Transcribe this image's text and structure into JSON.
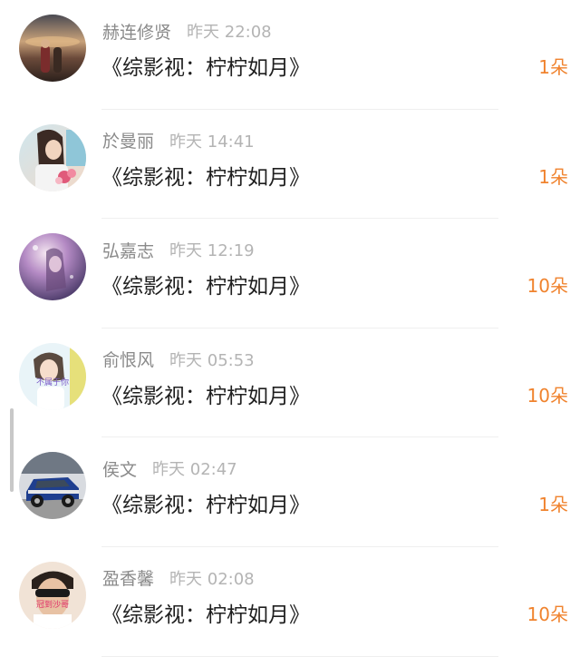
{
  "items": [
    {
      "name": "赫连修贤",
      "time": "昨天 22:08",
      "title": "《综影视：柠柠如月》",
      "count": "1朵",
      "avatar": "sunset-couple-avatar"
    },
    {
      "name": "於曼丽",
      "time": "昨天 14:41",
      "title": "《综影视：柠柠如月》",
      "count": "1朵",
      "avatar": "girl-flowers-avatar"
    },
    {
      "name": "弘嘉志",
      "time": "昨天 12:19",
      "title": "《综影视：柠柠如月》",
      "count": "10朵",
      "avatar": "purple-dreamy-avatar"
    },
    {
      "name": "俞恨风",
      "time": "昨天 05:53",
      "title": "《综影视：柠柠如月》",
      "count": "10朵",
      "avatar": "girl-text-avatar",
      "avatar_text": "不属于你"
    },
    {
      "name": "侯文",
      "time": "昨天 02:47",
      "title": "《综影视：柠柠如月》",
      "count": "1朵",
      "avatar": "rally-car-avatar"
    },
    {
      "name": "盈香馨",
      "time": "昨天 02:08",
      "title": "《综影视：柠柠如月》",
      "count": "10朵",
      "avatar": "man-sunglasses-avatar",
      "avatar_text": "冠到沙哥"
    }
  ],
  "colors": {
    "name": "#8a8a8a",
    "time": "#b4b4b4",
    "title": "#1f1f1f",
    "count": "#f0832e",
    "divider": "#efefef"
  }
}
